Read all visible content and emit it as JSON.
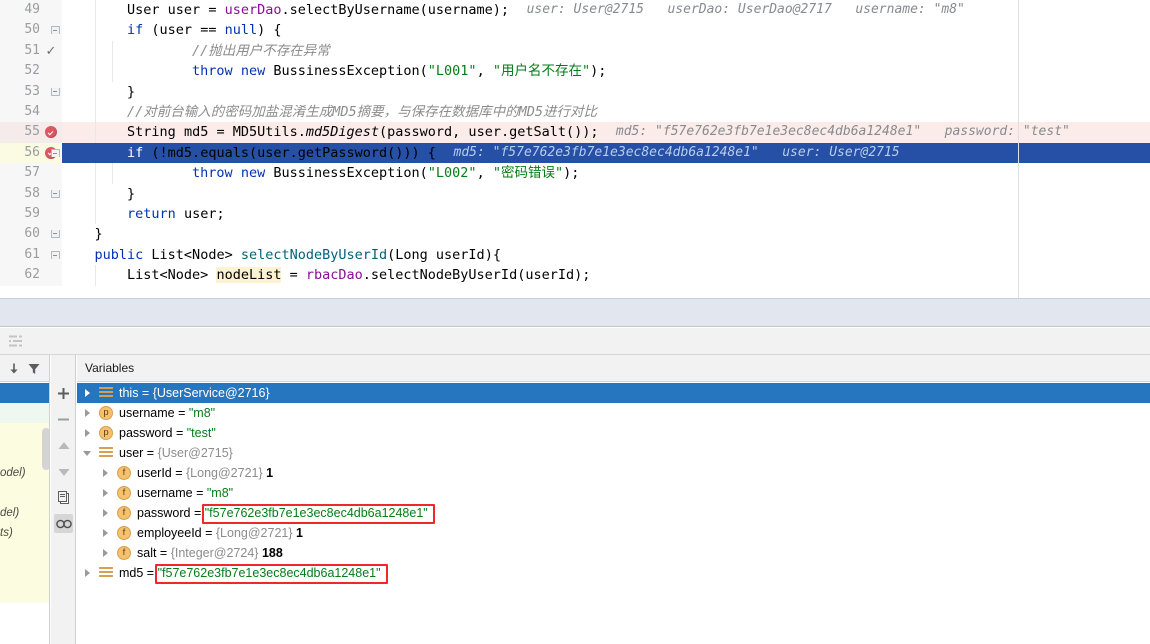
{
  "editor": {
    "margin_guide_x": 1018,
    "lines": [
      {
        "num": "49",
        "gutter": "none",
        "fold": "none",
        "bg": "none",
        "indent": 4,
        "tokens": [
          {
            "t": "User ",
            "c": "typ"
          },
          {
            "t": "user ",
            "c": "id"
          },
          {
            "t": "= ",
            "c": "id"
          },
          {
            "t": "userDao",
            "c": "fld"
          },
          {
            "t": ".selectByUsername(username);",
            "c": "id"
          }
        ],
        "hint": "user: User@2715   userDao: UserDao@2717   username: \"m8\""
      },
      {
        "num": "50",
        "gutter": "none",
        "fold": "down",
        "bg": "none",
        "indent": 4,
        "tokens": [
          {
            "t": "if ",
            "c": "kw"
          },
          {
            "t": "(user == ",
            "c": "id"
          },
          {
            "t": "null",
            "c": "kw"
          },
          {
            "t": ") {",
            "c": "id"
          }
        ],
        "hint": ""
      },
      {
        "num": "51",
        "gutter": "check",
        "fold": "none",
        "bg": "none",
        "indent": 8,
        "tokens": [
          {
            "t": "//抛出用户不存在异常",
            "c": "cmt"
          }
        ],
        "hint": ""
      },
      {
        "num": "52",
        "gutter": "none",
        "fold": "none",
        "bg": "none",
        "indent": 8,
        "tokens": [
          {
            "t": "throw ",
            "c": "kw"
          },
          {
            "t": "new ",
            "c": "kw"
          },
          {
            "t": "BussinessException(",
            "c": "id"
          },
          {
            "t": "\"L001\"",
            "c": "str"
          },
          {
            "t": ", ",
            "c": "id"
          },
          {
            "t": "\"用户名不存在\"",
            "c": "str"
          },
          {
            "t": ");",
            "c": "id"
          }
        ],
        "hint": ""
      },
      {
        "num": "53",
        "gutter": "none",
        "fold": "up",
        "bg": "none",
        "indent": 4,
        "tokens": [
          {
            "t": "}",
            "c": "id"
          }
        ],
        "hint": ""
      },
      {
        "num": "54",
        "gutter": "none",
        "fold": "none",
        "bg": "none",
        "indent": 4,
        "tokens": [
          {
            "t": "//对前台输入的密码加盐混淆生成MD5摘要，与保存在数据库中的MD5进行对比",
            "c": "cmt"
          }
        ],
        "hint": ""
      },
      {
        "num": "55",
        "gutter": "breakpoint",
        "fold": "none",
        "bg": "exec-pink",
        "indent": 4,
        "tokens": [
          {
            "t": "String ",
            "c": "typ"
          },
          {
            "t": "md5 = ",
            "c": "id"
          },
          {
            "t": "MD5Utils.",
            "c": "id"
          },
          {
            "t": "md5Digest",
            "c": "ital"
          },
          {
            "t": "(password, user.getSalt());",
            "c": "id"
          }
        ],
        "hint": "md5: \"f57e762e3fb7e1e3ec8ec4db6a1248e1\"   password: \"test\""
      },
      {
        "num": "56",
        "gutter": "breakpoint",
        "fold": "down",
        "bg": "selected-blue",
        "indent": 4,
        "tokens": [
          {
            "t": "if ",
            "c": "kw"
          },
          {
            "t": "(!md5.equals(user.getPassword())) {",
            "c": "id"
          }
        ],
        "hint": "md5: \"f57e762e3fb7e1e3ec8ec4db6a1248e1\"   user: User@2715"
      },
      {
        "num": "57",
        "gutter": "none",
        "fold": "none",
        "bg": "none",
        "indent": 8,
        "tokens": [
          {
            "t": "throw ",
            "c": "kw"
          },
          {
            "t": "new ",
            "c": "kw"
          },
          {
            "t": "BussinessException(",
            "c": "id"
          },
          {
            "t": "\"L002\"",
            "c": "str"
          },
          {
            "t": ", ",
            "c": "id"
          },
          {
            "t": "\"密码错误\"",
            "c": "str"
          },
          {
            "t": ");",
            "c": "id"
          }
        ],
        "hint": ""
      },
      {
        "num": "58",
        "gutter": "none",
        "fold": "up",
        "bg": "none",
        "indent": 4,
        "tokens": [
          {
            "t": "}",
            "c": "id"
          }
        ],
        "hint": ""
      },
      {
        "num": "59",
        "gutter": "none",
        "fold": "none",
        "bg": "none",
        "indent": 4,
        "tokens": [
          {
            "t": "return ",
            "c": "kw"
          },
          {
            "t": "user;",
            "c": "id"
          }
        ],
        "hint": ""
      },
      {
        "num": "60",
        "gutter": "none",
        "fold": "up",
        "bg": "none",
        "indent": 2,
        "tokens": [
          {
            "t": "}",
            "c": "id"
          }
        ],
        "hint": ""
      },
      {
        "num": "61",
        "gutter": "none",
        "fold": "down",
        "bg": "none",
        "indent": 2,
        "tokens": [
          {
            "t": "public ",
            "c": "kw"
          },
          {
            "t": "List<Node> ",
            "c": "id"
          },
          {
            "t": "selectNodeByUserId",
            "c": "fn"
          },
          {
            "t": "(",
            "c": "id"
          },
          {
            "t": "Long ",
            "c": "typ"
          },
          {
            "t": "userId){",
            "c": "id"
          }
        ],
        "hint": ""
      },
      {
        "num": "62",
        "gutter": "none",
        "fold": "none",
        "bg": "none",
        "indent": 4,
        "tokens": [
          {
            "t": "List<Node> ",
            "c": "id"
          },
          {
            "t": "nodeList",
            "c": "hl-ident"
          },
          {
            "t": " = ",
            "c": "id"
          },
          {
            "t": "rbacDao",
            "c": "fld"
          },
          {
            "t": ".selectNodeByUserId(userId);",
            "c": "id"
          }
        ],
        "hint": ""
      }
    ]
  },
  "debug_toolbar": {
    "settings_icon": "layout-settings-icon"
  },
  "frames_pane": {
    "toolbar": [
      {
        "icon": "arrow-down-icon"
      },
      {
        "icon": "filter-icon"
      }
    ],
    "rows": [
      {
        "text": "",
        "bg": "#2675bf"
      },
      {
        "text": "",
        "bg": "#eff8f0"
      },
      {
        "text": "",
        "bg": "#fcfce0"
      },
      {
        "text": "",
        "bg": "#fcfce0"
      },
      {
        "text": "odel)",
        "bg": "#fcfce0"
      },
      {
        "text": "",
        "bg": "#fcfce0"
      },
      {
        "text": "del)",
        "bg": "#fcfce0"
      },
      {
        "text": "ts)",
        "bg": "#fcfce0"
      },
      {
        "text": "",
        "bg": "#fcfce0"
      },
      {
        "text": "",
        "bg": "#fcfce0"
      },
      {
        "text": "",
        "bg": "#fcfce0"
      }
    ]
  },
  "vars_toolbar": {
    "buttons": [
      {
        "icon": "plus-icon",
        "glyph": "+",
        "active": false
      },
      {
        "icon": "minus-icon",
        "glyph": "−",
        "active": false
      },
      {
        "icon": "arrow-up-icon",
        "glyph": "▲",
        "active": false
      },
      {
        "icon": "arrow-down-icon",
        "glyph": "▼",
        "active": false
      },
      {
        "icon": "copy-icon",
        "glyph": "⧉",
        "active": false
      },
      {
        "icon": "watches-icon",
        "glyph": "∞",
        "active": true
      }
    ]
  },
  "vars_pane": {
    "header": "Variables",
    "rows": [
      {
        "indent": 0,
        "arrow": "closed",
        "icon": "object-icon",
        "name": "this",
        "eq": " = ",
        "type": "{UserService@2716}",
        "value": "",
        "selected": true,
        "boxed": false
      },
      {
        "indent": 0,
        "arrow": "closed",
        "icon": "p-icon",
        "name": "username",
        "eq": " = ",
        "type": "",
        "value": "\"m8\"",
        "selected": false,
        "boxed": false
      },
      {
        "indent": 0,
        "arrow": "closed",
        "icon": "p-icon",
        "name": "password",
        "eq": " = ",
        "type": "",
        "value": "\"test\"",
        "selected": false,
        "boxed": false
      },
      {
        "indent": 0,
        "arrow": "open",
        "icon": "object-icon",
        "name": "user",
        "eq": " = ",
        "type": "{User@2715}",
        "value": "",
        "selected": false,
        "boxed": false
      },
      {
        "indent": 1,
        "arrow": "closed",
        "icon": "f-icon",
        "name": "userId",
        "eq": " = ",
        "type": "{Long@2721}",
        "value": " 1",
        "selected": false,
        "boxed": false
      },
      {
        "indent": 1,
        "arrow": "closed",
        "icon": "f-icon",
        "name": "username",
        "eq": " = ",
        "type": "",
        "value": "\"m8\"",
        "selected": false,
        "boxed": false
      },
      {
        "indent": 1,
        "arrow": "closed",
        "icon": "f-icon",
        "name": "password",
        "eq": " = ",
        "type": "",
        "value": "\"f57e762e3fb7e1e3ec8ec4db6a1248e1\"",
        "selected": false,
        "boxed": true
      },
      {
        "indent": 1,
        "arrow": "closed",
        "icon": "f-icon",
        "name": "employeeId",
        "eq": " = ",
        "type": "{Long@2721}",
        "value": " 1",
        "selected": false,
        "boxed": false
      },
      {
        "indent": 1,
        "arrow": "closed",
        "icon": "f-icon",
        "name": "salt",
        "eq": " = ",
        "type": "{Integer@2724}",
        "value": " 188",
        "selected": false,
        "boxed": false
      },
      {
        "indent": 0,
        "arrow": "closed",
        "icon": "object-icon",
        "name": "md5",
        "eq": " = ",
        "type": "",
        "value": "\"f57e762e3fb7e1e3ec8ec4db6a1248e1\"",
        "selected": false,
        "boxed": true
      }
    ]
  },
  "colors": {
    "selection_blue": "#2675bf",
    "exec_line_pink": "#fbece9",
    "breakpoint_red": "#db5860",
    "annotation_red": "#ef2929",
    "string_green": "#067d17",
    "keyword_blue": "#0033b3",
    "comment_grey": "#8c8c8c"
  }
}
